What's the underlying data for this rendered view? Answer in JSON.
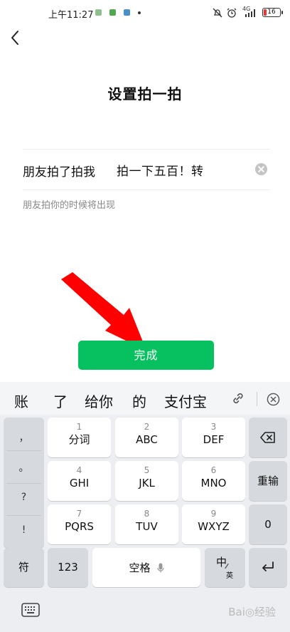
{
  "status_bar": {
    "time": "上午11:27",
    "network": "4G",
    "battery": "16",
    "app_icon_colors": [
      "#8cc08c",
      "#52a852",
      "#4a90c8"
    ]
  },
  "header": {
    "back_icon": "chevron-left-icon",
    "title": "设置拍一拍"
  },
  "pat": {
    "prefix": "朋友拍了拍我",
    "value": "拍一下五百！转",
    "hint": "朋友拍你的时候将出现"
  },
  "done_button": {
    "label": "完成",
    "color": "#07c160"
  },
  "annotation": {
    "arrow_color": "#ff0000"
  },
  "keyboard": {
    "candidates": [
      "账",
      "了",
      "给你",
      "的",
      "支付宝"
    ],
    "punctuation": [
      "，",
      "。",
      "?",
      "!"
    ],
    "keys": [
      {
        "num": "1",
        "label": "分词"
      },
      {
        "num": "2",
        "label": "ABC"
      },
      {
        "num": "3",
        "label": "DEF"
      },
      {
        "num": "4",
        "label": "GHI"
      },
      {
        "num": "5",
        "label": "JKL"
      },
      {
        "num": "6",
        "label": "MNO"
      },
      {
        "num": "7",
        "label": "PQRS"
      },
      {
        "num": "8",
        "label": "TUV"
      },
      {
        "num": "9",
        "label": "WXYZ"
      }
    ],
    "rechoose": "重输",
    "zero": "0",
    "symbol": "符",
    "numeric": "123",
    "space": "空格",
    "lang_main": "中",
    "lang_sub": "英"
  },
  "watermark": "Bai◎经验"
}
